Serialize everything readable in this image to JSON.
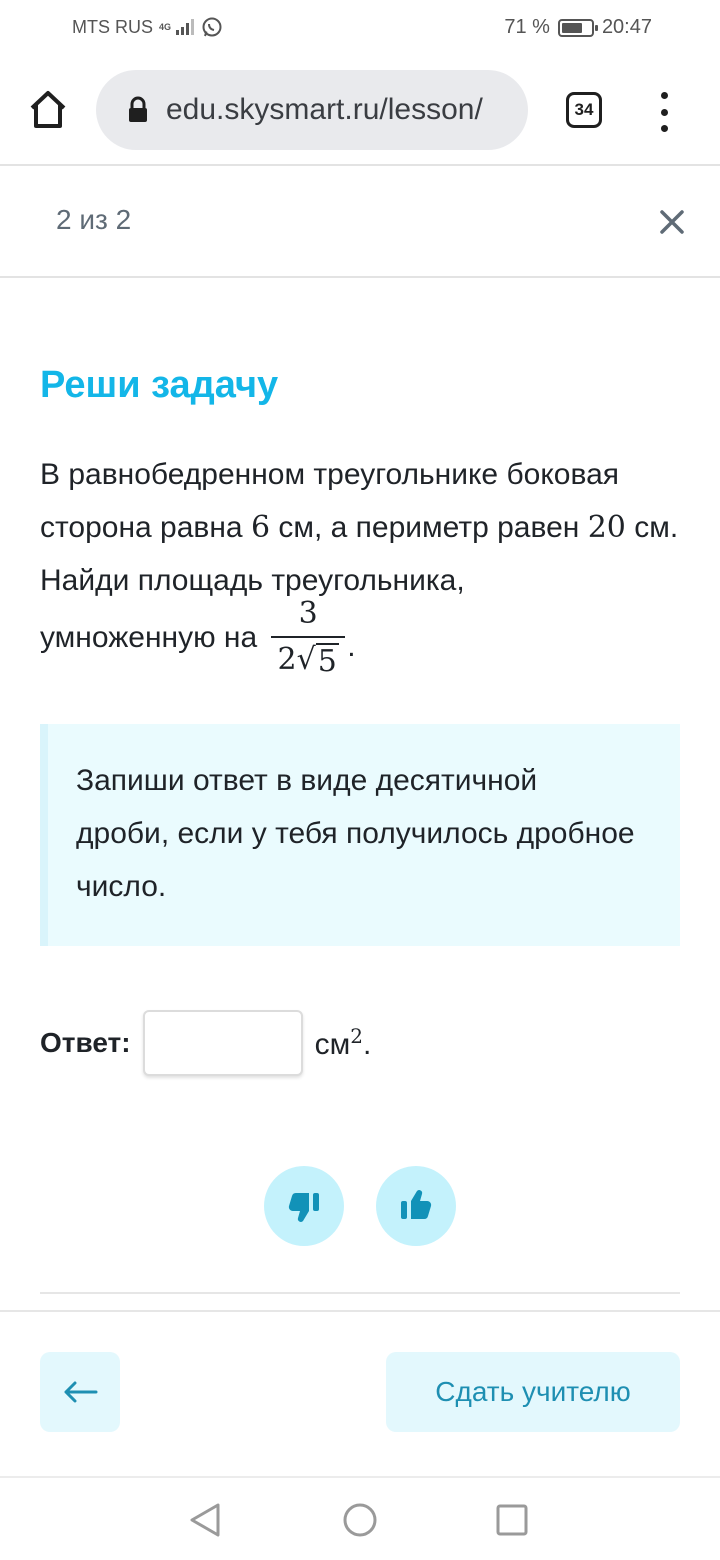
{
  "status_bar": {
    "carrier": "MTS RUS",
    "network_tag": "4G",
    "battery_percent": "71 %",
    "battery_level": 0.71,
    "time": "20:47"
  },
  "browser": {
    "url": "edu.skysmart.ru/lesson/",
    "tab_count": "34",
    "icons": [
      "home-icon",
      "lock-icon",
      "tabs-icon",
      "menu-icon"
    ]
  },
  "lesson": {
    "progress": "2 из 2",
    "title": "Реши задачу",
    "task_line1_pre": "В равнобедренном треугольнике боковая сторона равна ",
    "task_side": "6",
    "task_line1_mid": " см, а периметр равен ",
    "task_perimeter": "20",
    "task_line1_post": " см. Найди площадь треугольника,",
    "task_line2": "умноженную на",
    "fraction_numerator": "3",
    "fraction_den_coef": "2",
    "fraction_den_root": "5",
    "fraction_end": "."
  },
  "hint": {
    "text": "Запиши ответ в виде десятичной дроби, если у тебя получилось дробное число."
  },
  "answer": {
    "label": "Ответ:",
    "value": "",
    "unit": "см",
    "unit_power": "2",
    "unit_end": "."
  },
  "actions": {
    "submit_label": "Сдать учителю",
    "back_icon": "arrow-left-icon"
  },
  "colors": {
    "accent": "#13b6e8",
    "hint_bg": "#eafbfe",
    "button_bg": "#e3f8fd",
    "feedback_bg": "#c4f2fc",
    "button_text": "#1e8fb2"
  }
}
